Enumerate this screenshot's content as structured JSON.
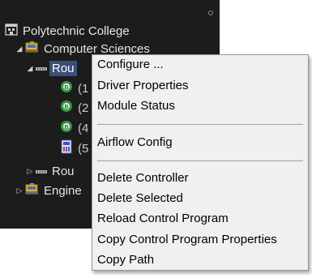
{
  "tree": {
    "root": {
      "label": "Polytechnic College",
      "icon": "building-icon"
    },
    "cs": {
      "label": "Computer Sciences",
      "icon": "department-icon"
    },
    "router1": {
      "label": "Rou",
      "icon": "router-icon"
    },
    "devices": [
      {
        "label": "(1",
        "icon": "bacnet-device-icon"
      },
      {
        "label": "(2",
        "icon": "bacnet-device-icon"
      },
      {
        "label": "(4",
        "icon": "bacnet-device-icon"
      },
      {
        "label": "(5",
        "icon": "controller-icon"
      }
    ],
    "router2": {
      "label": "Rou",
      "icon": "router-icon"
    },
    "eng": {
      "label": "Engine",
      "icon": "department-icon"
    }
  },
  "context_menu": {
    "group1": [
      "Configure ...",
      "Driver Properties",
      "Module Status"
    ],
    "group2": [
      "Airflow Config"
    ],
    "group3": [
      "Delete Controller",
      "Delete Selected",
      "Reload Control Program",
      "Copy Control Program Properties",
      "Copy Path"
    ]
  },
  "colors": {
    "tree_bg": "#1c1c1c",
    "selection": "#3a4f7a",
    "menu_bg": "#f0f0f0",
    "bacnet_green": "#2e9a3c"
  }
}
